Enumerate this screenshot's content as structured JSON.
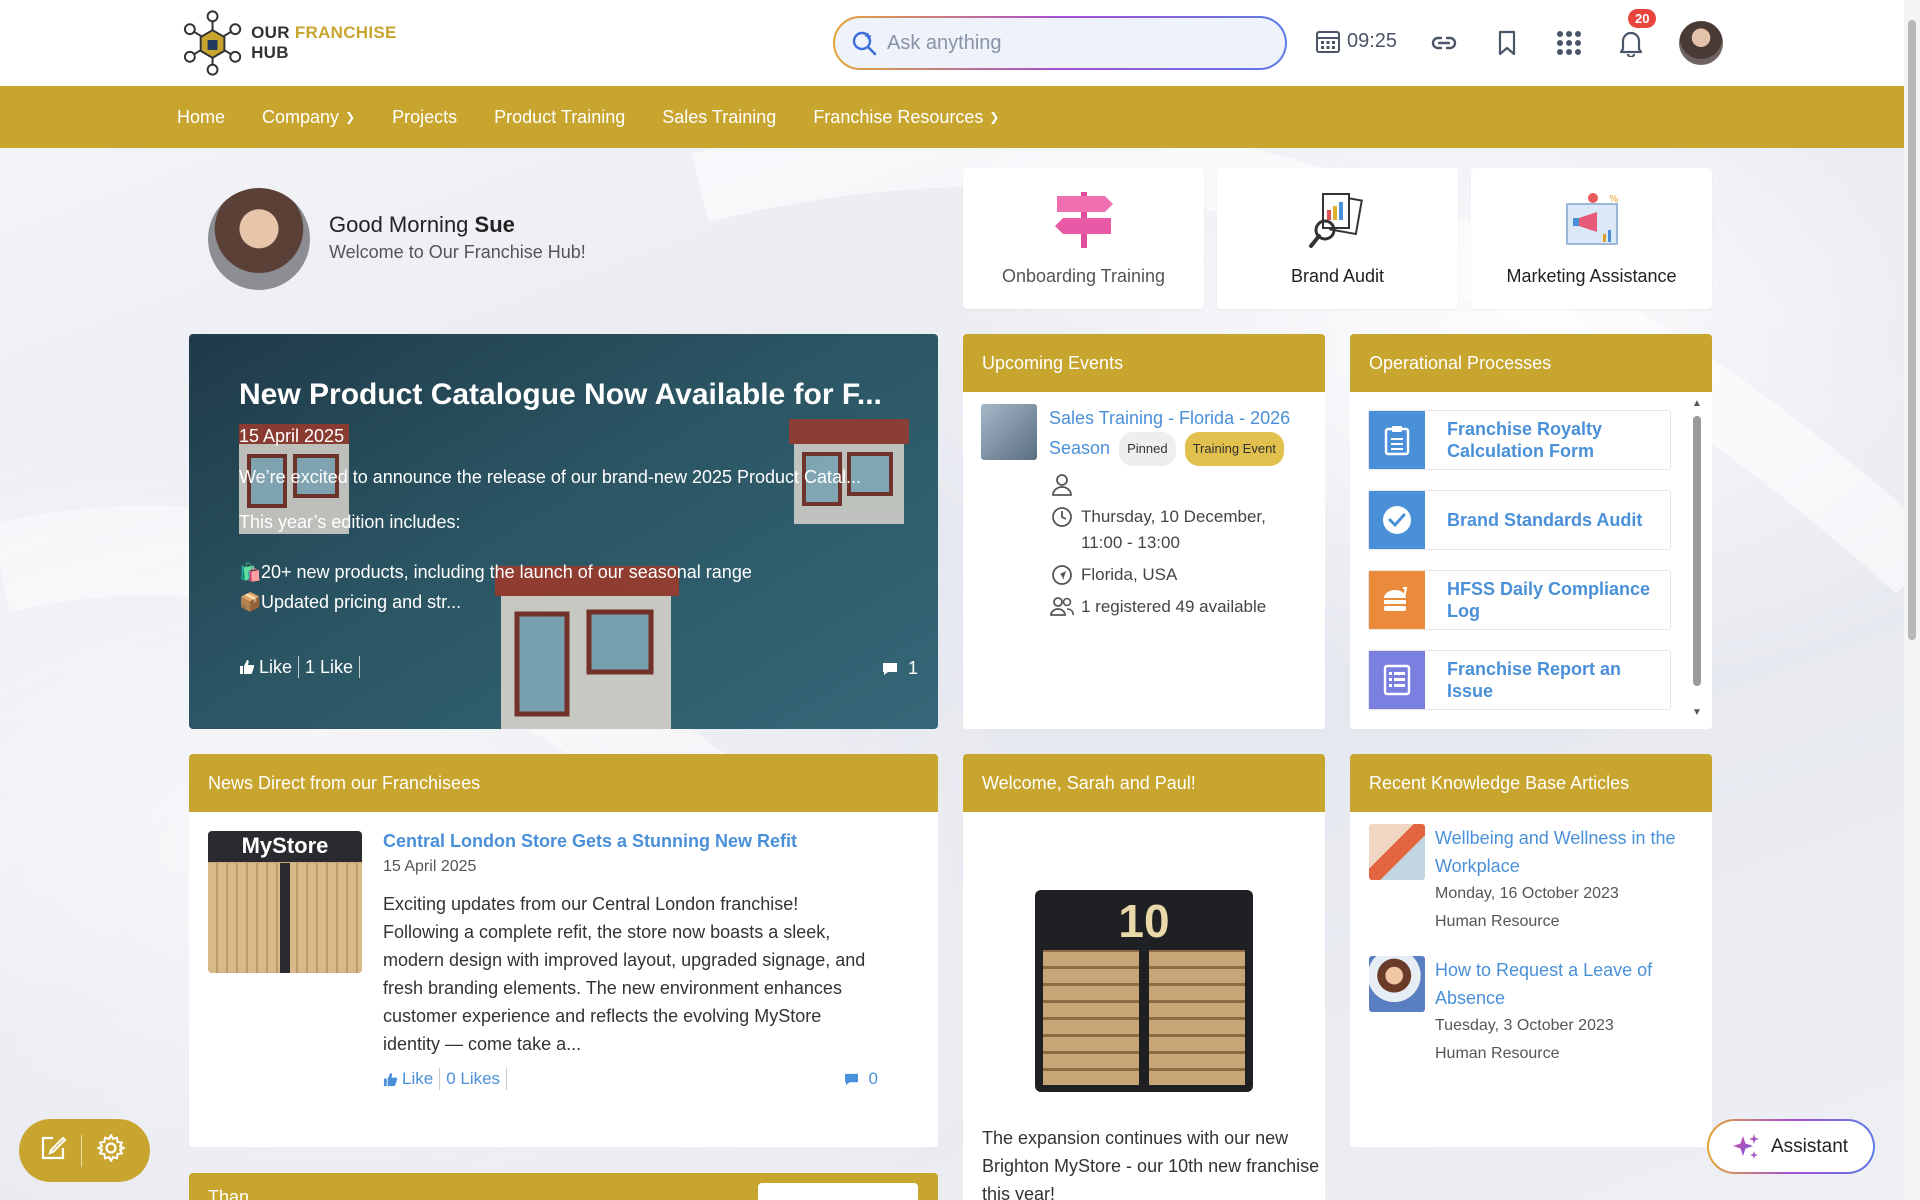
{
  "brand": {
    "name_part1": "OUR",
    "name_part2": "FRANCHISE",
    "name_part3": "HUB",
    "accent": "#c8a52e",
    "link": "#4a90d9"
  },
  "header": {
    "search_placeholder": "Ask anything",
    "time": "09:25",
    "notifications_count": "20",
    "icons": [
      "search-icon",
      "calendar-icon",
      "link-icon",
      "bookmark-icon",
      "apps-grid-icon",
      "bell-icon"
    ]
  },
  "nav": {
    "items": [
      {
        "label": "Home"
      },
      {
        "label": "Company",
        "dropdown": true
      },
      {
        "label": "Projects"
      },
      {
        "label": "Product Training"
      },
      {
        "label": "Sales Training"
      },
      {
        "label": "Franchise Resources",
        "dropdown": true
      }
    ]
  },
  "greeting": {
    "prefix": "Good Morning",
    "name": "Sue",
    "welcome": "Welcome to Our Franchise Hub!"
  },
  "tiles": [
    {
      "label": "Onboarding Training",
      "icon": "signpost-icon"
    },
    {
      "label": "Brand Audit",
      "icon": "audit-magnifier-icon"
    },
    {
      "label": "Marketing Assistance",
      "icon": "megaphone-board-icon"
    }
  ],
  "hero": {
    "title": "New Product Catalogue Now Available for F...",
    "date": "15 April 2025",
    "excerpt": "We’re excited to announce the release of our brand-new 2025 Product Catal...",
    "intro": "This year’s edition includes:",
    "bullets": [
      {
        "emoji": "🛍️",
        "text": "20+ new products, including the launch of our seasonal range"
      },
      {
        "emoji": "📦",
        "text": "Updated pricing and str..."
      }
    ],
    "like_label": "Like",
    "likes_count": "1 Like",
    "comments": "1"
  },
  "events": {
    "heading": "Upcoming Events",
    "items": [
      {
        "title": "Sales Training - Florida - 2026 Season",
        "pill_pinned": "Pinned",
        "pill_type": "Training Event",
        "datetime": "Thursday, 10 December, 11:00 - 13:00",
        "location": "Florida, USA",
        "registration": "1 registered 49 available"
      }
    ]
  },
  "operational": {
    "heading": "Operational Processes",
    "items": [
      {
        "label": "Franchise Royalty Calculation Form",
        "color": "#4a90d9",
        "icon": "clipboard-icon"
      },
      {
        "label": "Brand Standards Audit",
        "color": "#4a90d9",
        "icon": "check-circle-icon"
      },
      {
        "label": "HFSS Daily Compliance Log",
        "color": "#ea8b3c",
        "icon": "food-icon"
      },
      {
        "label": "Franchise Report an Issue",
        "color": "#7b7fe0",
        "icon": "list-doc-icon"
      }
    ]
  },
  "news": {
    "heading": "News Direct from our Franchisees",
    "image_sign": "MyStore",
    "title": "Central London Store Gets a Stunning New Refit",
    "date": "15 April 2025",
    "desc": "Exciting updates from our Central London franchise! Following a complete refit, the store now boasts a sleek, modern design with improved layout, upgraded signage, and fresh branding elements. The new environment enhances customer experience and reflects the evolving MyStore identity — come take a...",
    "like_label": "Like",
    "likes_count": "0 Likes",
    "comments": "0"
  },
  "welcome": {
    "heading": "Welcome, Sarah and Paul!",
    "image_number": "10",
    "text": "The expansion continues with our new Brighton MyStore - our 10th new franchise this year!"
  },
  "kb": {
    "heading": "Recent Knowledge Base Articles",
    "items": [
      {
        "title": "Wellbeing and Wellness in the Workplace",
        "date": "Monday, 16 October 2023",
        "category": "Human Resource"
      },
      {
        "title": "How to Request a Leave of Absence",
        "date": "Tuesday, 3 October 2023",
        "category": "Human Resource"
      }
    ]
  },
  "next_section": {
    "heading": "Than"
  },
  "assistant": {
    "label": "Assistant"
  }
}
